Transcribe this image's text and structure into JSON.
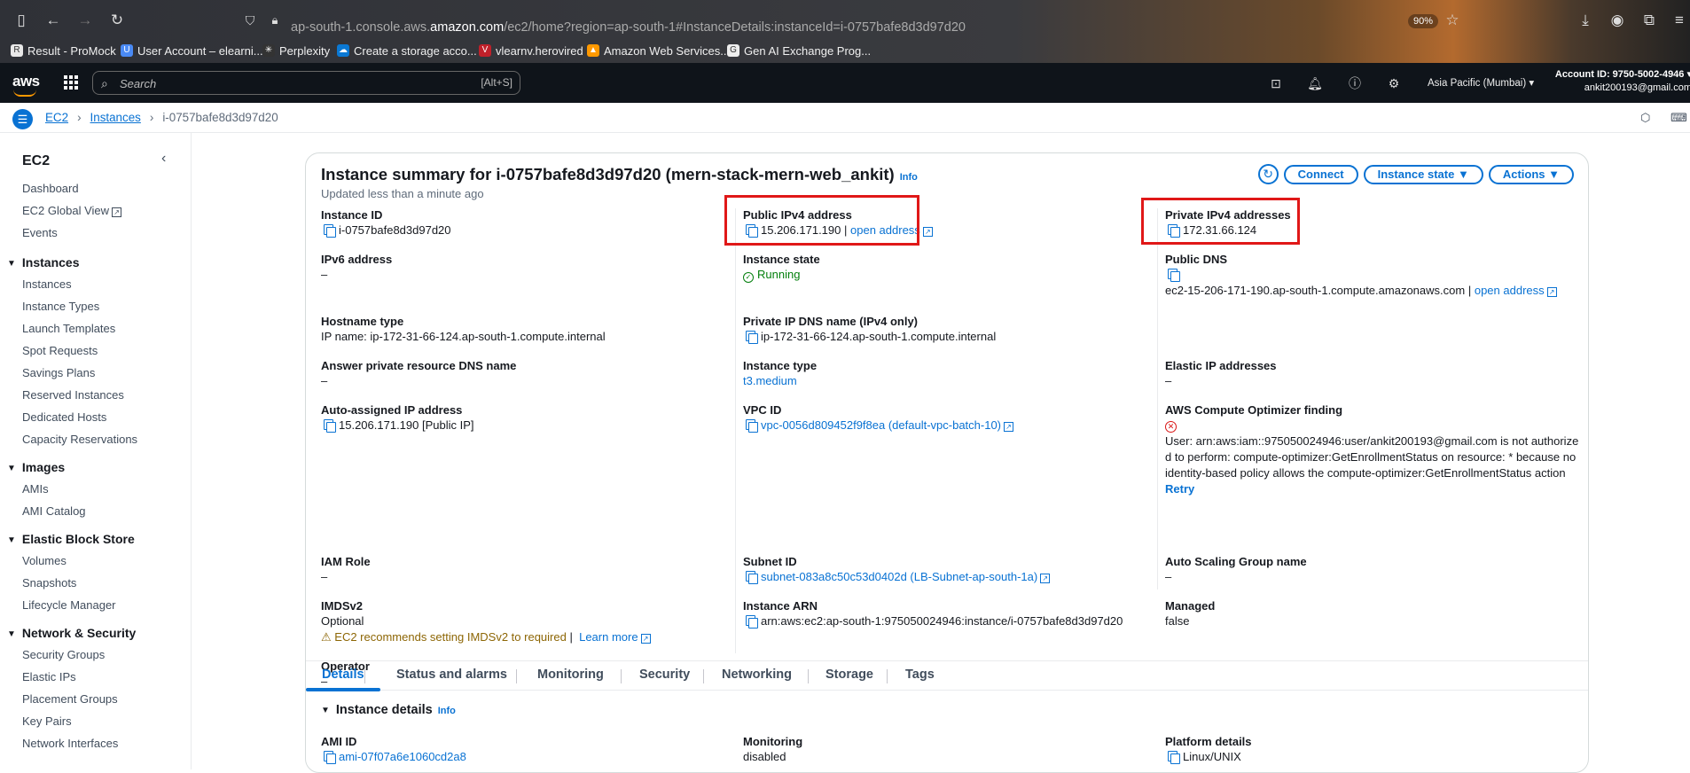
{
  "browser": {
    "url_prefix": "ap-south-1.console.aws.",
    "url_domain": "amazon.com",
    "url_suffix": "/ec2/home?region=ap-south-1#InstanceDetails:instanceId=i-0757bafe8d3d97d20",
    "zoom": "90%",
    "bookmarks": [
      "Result - ProMock",
      "User Account – elearni...",
      "Perplexity",
      "Create a storage acco...",
      "vlearnv.herovired",
      "Amazon Web Services...",
      "Gen AI Exchange Prog..."
    ]
  },
  "console": {
    "logo": "aws",
    "search_placeholder": "Search",
    "search_shortcut": "[Alt+S]",
    "region": "Asia Pacific (Mumbai)",
    "account_id": "Account ID: 9750-5002-4946",
    "account_user": "ankit200193@gmail.com"
  },
  "breadcrumb": {
    "service": "EC2",
    "section": "Instances",
    "current": "i-0757bafe8d3d97d20"
  },
  "sidebar": {
    "title": "EC2",
    "top_items": [
      "Dashboard",
      "EC2 Global View",
      "Events"
    ],
    "sections": [
      {
        "title": "Instances",
        "items": [
          "Instances",
          "Instance Types",
          "Launch Templates",
          "Spot Requests",
          "Savings Plans",
          "Reserved Instances",
          "Dedicated Hosts",
          "Capacity Reservations"
        ]
      },
      {
        "title": "Images",
        "items": [
          "AMIs",
          "AMI Catalog"
        ]
      },
      {
        "title": "Elastic Block Store",
        "items": [
          "Volumes",
          "Snapshots",
          "Lifecycle Manager"
        ]
      },
      {
        "title": "Network & Security",
        "items": [
          "Security Groups",
          "Elastic IPs",
          "Placement Groups",
          "Key Pairs",
          "Network Interfaces"
        ]
      }
    ]
  },
  "summary": {
    "title": "Instance summary for i-0757bafe8d3d97d20 (mern-stack-mern-web_ankit)",
    "info": "Info",
    "updated": "Updated less than a minute ago",
    "buttons": {
      "connect": "Connect",
      "instance_state": "Instance state",
      "actions": "Actions"
    },
    "col1": {
      "instance_id_label": "Instance ID",
      "instance_id": "i-0757bafe8d3d97d20",
      "ipv6_label": "IPv6 address",
      "ipv6": "–",
      "hostname_label": "Hostname type",
      "hostname": "IP name: ip-172-31-66-124.ap-south-1.compute.internal",
      "answer_label": "Answer private resource DNS name",
      "answer": "–",
      "auto_ip_label": "Auto-assigned IP address",
      "auto_ip": "15.206.171.190 [Public IP]",
      "iam_label": "IAM Role",
      "iam": "–",
      "imds_label": "IMDSv2",
      "imds": "Optional",
      "imds_warn": "EC2 recommends setting IMDSv2 to required",
      "imds_sep": "|",
      "learn_more": "Learn more",
      "operator_label": "Operator",
      "operator": "–"
    },
    "col2": {
      "public_ip_label": "Public IPv4 address",
      "public_ip": "15.206.171.190",
      "public_ip_sep": "|",
      "open_address": "open address",
      "state_label": "Instance state",
      "state": "Running",
      "private_dns_label": "Private IP DNS name (IPv4 only)",
      "private_dns": "ip-172-31-66-124.ap-south-1.compute.internal",
      "type_label": "Instance type",
      "type": "t3.medium",
      "vpc_label": "VPC ID",
      "vpc": "vpc-0056d809452f9f8ea (default-vpc-batch-10)",
      "subnet_label": "Subnet ID",
      "subnet": "subnet-083a8c50c53d0402d (LB-Subnet-ap-south-1a)",
      "arn_label": "Instance ARN",
      "arn": "arn:aws:ec2:ap-south-1:975050024946:instance/i-0757bafe8d3d97d20"
    },
    "col3": {
      "private_ip_label": "Private IPv4 addresses",
      "private_ip": "172.31.66.124",
      "public_dns_label": "Public DNS",
      "public_dns": "ec2-15-206-171-190.ap-south-1.compute.amazonaws.com",
      "public_dns_sep": "|",
      "open_address": "open address",
      "elastic_label": "Elastic IP addresses",
      "elastic": "–",
      "optimizer_label": "AWS Compute Optimizer finding",
      "optimizer_line1": "User: arn:aws:iam::975050024946:user/ankit200193@gmail.com is not authorize",
      "optimizer_line2": "d to perform: compute-optimizer:GetEnrollmentStatus on resource: * because no",
      "optimizer_line3": "identity-based policy allows the compute-optimizer:GetEnrollmentStatus action",
      "retry": "Retry",
      "asg_label": "Auto Scaling Group name",
      "asg": "–",
      "managed_label": "Managed",
      "managed": "false"
    }
  },
  "tabs": [
    "Details",
    "Status and alarms",
    "Monitoring",
    "Security",
    "Networking",
    "Storage",
    "Tags"
  ],
  "details": {
    "title": "Instance details",
    "info": "Info",
    "ami_label": "AMI ID",
    "ami": "ami-07f07a6e1060cd2a8",
    "monitoring_label": "Monitoring",
    "monitoring": "disabled",
    "platform_label": "Platform details",
    "platform": "Linux/UNIX"
  }
}
